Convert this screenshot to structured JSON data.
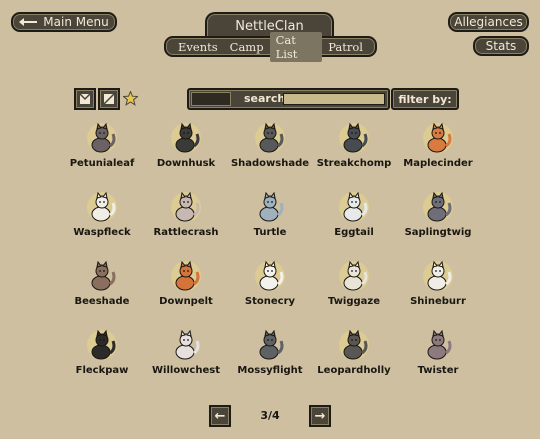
{
  "nav": {
    "main_menu": "Main Menu",
    "allegiances": "Allegiances",
    "stats": "Stats"
  },
  "clan": {
    "name": "NettleClan"
  },
  "tabs": [
    {
      "label": "Events",
      "active": false
    },
    {
      "label": "Camp",
      "active": false
    },
    {
      "label": "Cat List",
      "active": true
    },
    {
      "label": "Patrol",
      "active": false
    }
  ],
  "toolbar": {
    "search_label": "search",
    "search_value": "",
    "filter_label": "filter by:"
  },
  "cats": [
    {
      "name": "Petunialeaf",
      "color": "#6c6266",
      "halo": true
    },
    {
      "name": "Downhusk",
      "color": "#3a3a38",
      "halo": true
    },
    {
      "name": "Shadowshade",
      "color": "#57595b",
      "halo": true
    },
    {
      "name": "Streakchomp",
      "color": "#464c51",
      "halo": true
    },
    {
      "name": "Maplecinder",
      "color": "#d97a3f",
      "halo": true
    },
    {
      "name": "Waspfleck",
      "color": "#f1eee6",
      "halo": true
    },
    {
      "name": "Rattlecrash",
      "color": "#c8b8b2",
      "halo": true
    },
    {
      "name": "Turtle",
      "color": "#9fb1bd",
      "halo": false
    },
    {
      "name": "Eggtail",
      "color": "#e8eaea",
      "halo": true
    },
    {
      "name": "Saplingtwig",
      "color": "#6e6e7a",
      "halo": true
    },
    {
      "name": "Beeshade",
      "color": "#8a6e5e",
      "halo": false
    },
    {
      "name": "Downpelt",
      "color": "#d4733a",
      "halo": true
    },
    {
      "name": "Stonecry",
      "color": "#f4f2ec",
      "halo": true
    },
    {
      "name": "Twiggaze",
      "color": "#e9e4d8",
      "halo": true
    },
    {
      "name": "Shineburr",
      "color": "#f0ede6",
      "halo": true
    },
    {
      "name": "Fleckpaw",
      "color": "#2c2b29",
      "halo": true
    },
    {
      "name": "Willowchest",
      "color": "#e6e1de",
      "halo": false
    },
    {
      "name": "Mossyflight",
      "color": "#5f6264",
      "halo": false
    },
    {
      "name": "Leopardholly",
      "color": "#5a5653",
      "halo": true
    },
    {
      "name": "Twister",
      "color": "#8c7a7e",
      "halo": false
    }
  ],
  "pagination": {
    "current": "3/4",
    "prev_icon": "arrow-left-icon",
    "next_icon": "arrow-right-icon"
  },
  "colors": {
    "background": "#cdbfa0",
    "button": "#4a4538",
    "halo": "#dccb93",
    "star": "#e9c64a"
  }
}
